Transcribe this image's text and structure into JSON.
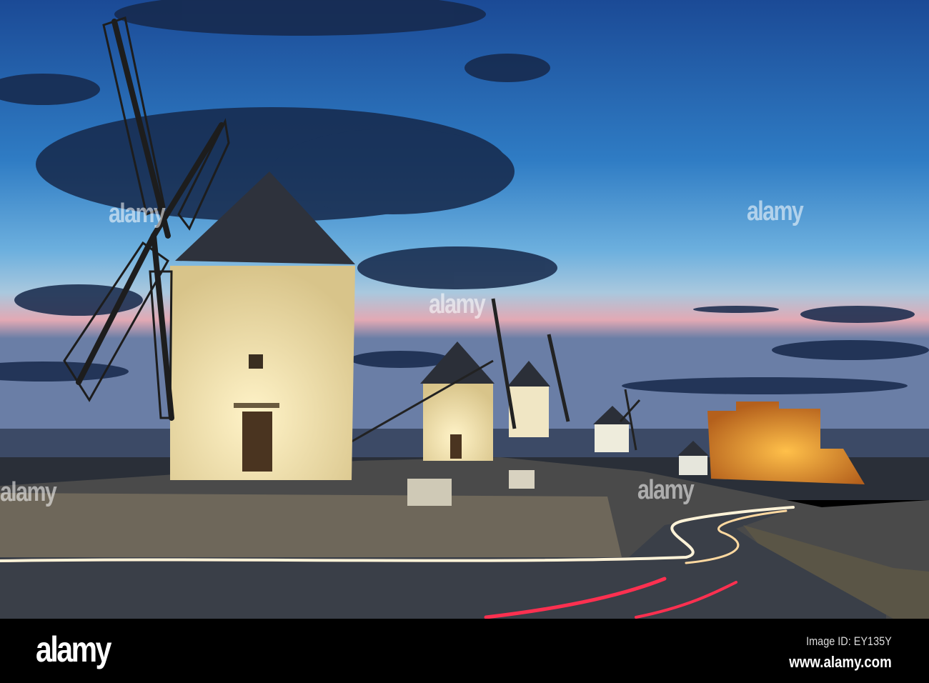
{
  "photo": {
    "subject": "windmills-and-castle-at-dusk",
    "colors": {
      "sky_top": "#1a4f9a",
      "sky_mid": "#3f8fd0",
      "horizon": "#e7a0a8",
      "mill_wall": "#f2e3b0",
      "castle": "#e89a2c",
      "road": "#3a3f48",
      "trail_white": "#fff3d8",
      "trail_red": "#ff3050"
    }
  },
  "watermark": {
    "text": "alamy"
  },
  "footer": {
    "brand": "alamy",
    "image_id": "Image ID: EY135Y",
    "website": "www.alamy.com"
  }
}
